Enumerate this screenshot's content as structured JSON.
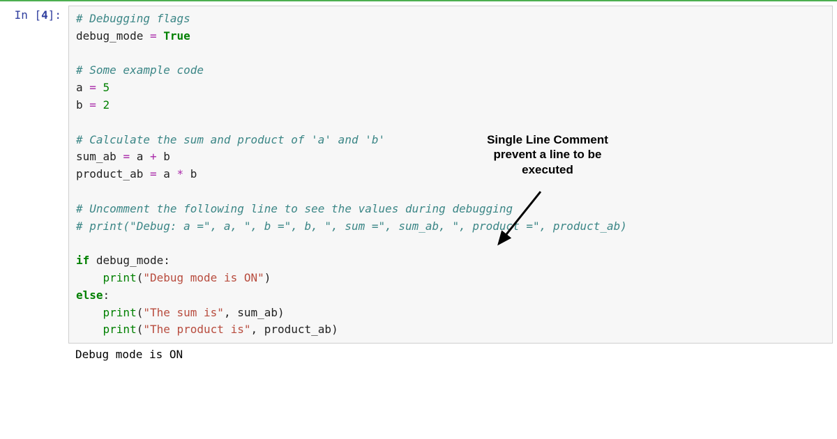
{
  "prompt": {
    "prefix": "In [",
    "num": "4",
    "suffix": "]:"
  },
  "code": {
    "l1": "# Debugging flags",
    "l2a": "debug_mode ",
    "l2b": "=",
    "l2c": " ",
    "l2d": "True",
    "l3": "",
    "l4": "# Some example code",
    "l5a": "a ",
    "l5b": "=",
    "l5c": " ",
    "l5d": "5",
    "l6a": "b ",
    "l6b": "=",
    "l6c": " ",
    "l6d": "2",
    "l7": "",
    "l8": "# Calculate the sum and product of 'a' and 'b'",
    "l9a": "sum_ab ",
    "l9b": "=",
    "l9c": " a ",
    "l9d": "+",
    "l9e": " b",
    "l10a": "product_ab ",
    "l10b": "=",
    "l10c": " a ",
    "l10d": "*",
    "l10e": " b",
    "l11": "",
    "l12": "# Uncomment the following line to see the values during debugging",
    "l13": "# print(\"Debug: a =\", a, \", b =\", b, \", sum =\", sum_ab, \", product =\", product_ab)",
    "l14": "",
    "l15a": "if",
    "l15b": " debug_mode:",
    "l16a": "    ",
    "l16b": "print",
    "l16c": "(",
    "l16d": "\"Debug mode is ON\"",
    "l16e": ")",
    "l17a": "else",
    "l17b": ":",
    "l18a": "    ",
    "l18b": "print",
    "l18c": "(",
    "l18d": "\"The sum is\"",
    "l18e": ", sum_ab)",
    "l19a": "    ",
    "l19b": "print",
    "l19c": "(",
    "l19d": "\"The product is\"",
    "l19e": ", product_ab)"
  },
  "output": "Debug mode is ON",
  "annotation": {
    "line1": "Single Line Comment",
    "line2": "prevent a line to be",
    "line3": "executed"
  }
}
